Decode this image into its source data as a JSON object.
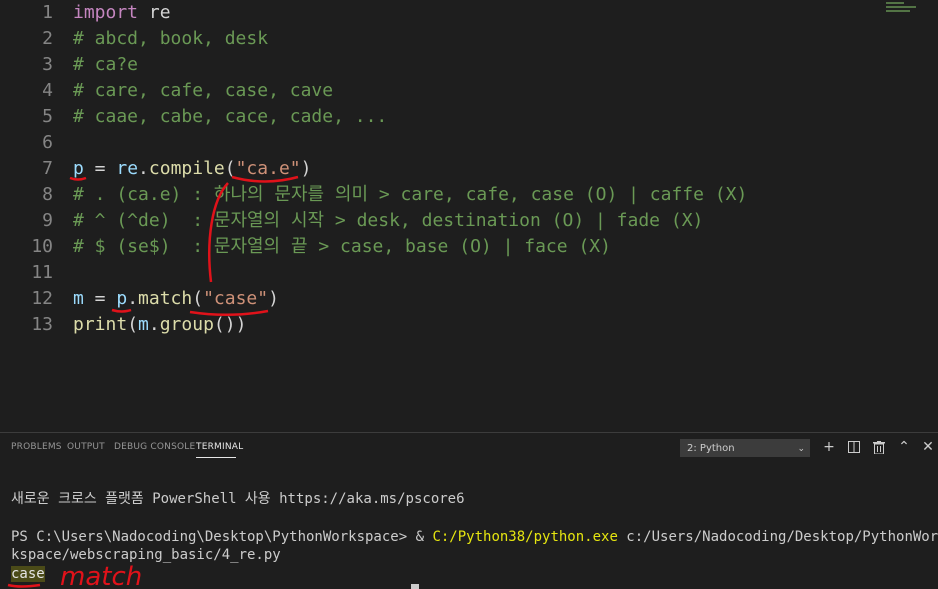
{
  "editor": {
    "lines": [
      {
        "num": "1",
        "tokens": [
          {
            "t": "import",
            "c": "kw"
          },
          {
            "t": " re",
            "c": "op"
          }
        ]
      },
      {
        "num": "2",
        "tokens": [
          {
            "t": "# abcd, book, desk",
            "c": "cm"
          }
        ]
      },
      {
        "num": "3",
        "tokens": [
          {
            "t": "# ca?e",
            "c": "cm"
          }
        ]
      },
      {
        "num": "4",
        "tokens": [
          {
            "t": "# care, cafe, case, cave",
            "c": "cm"
          }
        ]
      },
      {
        "num": "5",
        "tokens": [
          {
            "t": "# caae, cabe, cace, cade, ...",
            "c": "cm"
          }
        ]
      },
      {
        "num": "6",
        "tokens": []
      },
      {
        "num": "7",
        "tokens": [
          {
            "t": "p",
            "c": "var"
          },
          {
            "t": " = ",
            "c": "op"
          },
          {
            "t": "re",
            "c": "var"
          },
          {
            "t": ".",
            "c": "op"
          },
          {
            "t": "compile",
            "c": "fn"
          },
          {
            "t": "(",
            "c": "op"
          },
          {
            "t": "\"ca.e\"",
            "c": "str"
          },
          {
            "t": ")",
            "c": "op"
          }
        ]
      },
      {
        "num": "8",
        "tokens": [
          {
            "t": "# . (ca.e) : 하나의 문자를 의미 > care, cafe, case (O) | caffe (X)",
            "c": "cm"
          }
        ]
      },
      {
        "num": "9",
        "tokens": [
          {
            "t": "# ^ (^de)  : 문자열의 시작 > desk, destination (O) | fade (X)",
            "c": "cm"
          }
        ]
      },
      {
        "num": "10",
        "tokens": [
          {
            "t": "# $ (se$)  : 문자열의 끝 > case, base (O) | face (X)",
            "c": "cm"
          }
        ]
      },
      {
        "num": "11",
        "tokens": []
      },
      {
        "num": "12",
        "tokens": [
          {
            "t": "m",
            "c": "var"
          },
          {
            "t": " = ",
            "c": "op"
          },
          {
            "t": "p",
            "c": "var"
          },
          {
            "t": ".",
            "c": "op"
          },
          {
            "t": "match",
            "c": "fn"
          },
          {
            "t": "(",
            "c": "op"
          },
          {
            "t": "\"case\"",
            "c": "str"
          },
          {
            "t": ")",
            "c": "op"
          }
        ]
      },
      {
        "num": "13",
        "tokens": [
          {
            "t": "print",
            "c": "fn"
          },
          {
            "t": "(",
            "c": "op"
          },
          {
            "t": "m",
            "c": "var"
          },
          {
            "t": ".",
            "c": "op"
          },
          {
            "t": "group",
            "c": "fn"
          },
          {
            "t": "()",
            "c": "op"
          },
          {
            "t": ")",
            "c": "op"
          }
        ]
      }
    ]
  },
  "panel": {
    "tabs": [
      {
        "label": "PROBLEMS",
        "active": false
      },
      {
        "label": "OUTPUT",
        "active": false
      },
      {
        "label": "DEBUG CONSOLE",
        "active": false
      },
      {
        "label": "TERMINAL",
        "active": true
      }
    ],
    "terminal_select": "2: Python",
    "icons": [
      "plus-icon",
      "split-icon",
      "trash-icon",
      "chevron-up-icon",
      "close-icon"
    ]
  },
  "terminal": {
    "banner": "새로운 크로스 플랫폼 PowerShell 사용 https://aka.ms/pscore6",
    "prompt": "PS C:\\Users\\Nadocoding\\Desktop\\PythonWorkspace> & ",
    "exe": "C:/Python38/python.exe",
    "args_line1": " c:/Users/Nadocoding/Desktop/PythonWor",
    "args_line2": "kspace/webscraping_basic/4_re.py",
    "output": "case"
  },
  "colors": {
    "annotation": "#e0121a"
  },
  "annotation_text": "match"
}
